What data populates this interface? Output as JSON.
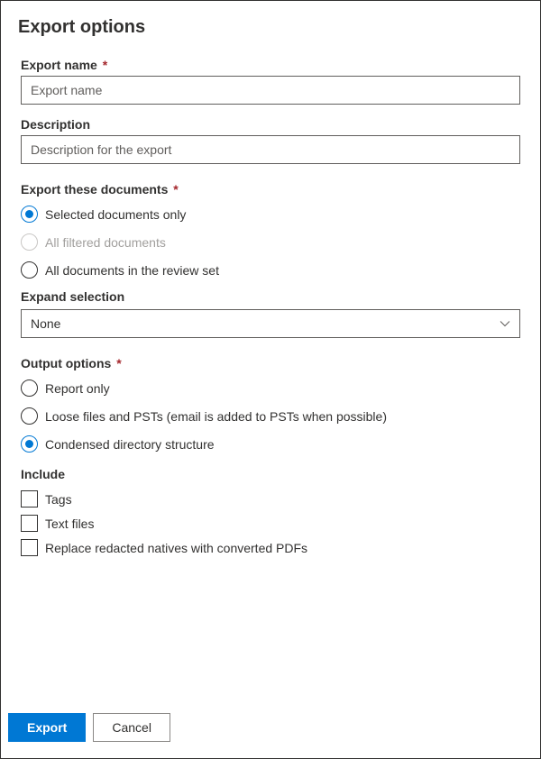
{
  "title": "Export options",
  "fields": {
    "exportName": {
      "label": "Export name",
      "placeholder": "Export name",
      "required": "*"
    },
    "description": {
      "label": "Description",
      "placeholder": "Description for the export"
    }
  },
  "exportDocuments": {
    "label": "Export these documents",
    "required": "*",
    "options": {
      "selected": "Selected documents only",
      "filtered": "All filtered documents",
      "all": "All documents in the review set"
    }
  },
  "expandSelection": {
    "label": "Expand selection",
    "value": "None"
  },
  "outputOptions": {
    "label": "Output options",
    "required": "*",
    "options": {
      "report": "Report only",
      "loose": "Loose files and PSTs (email is added to PSTs when possible)",
      "condensed": "Condensed directory structure"
    }
  },
  "include": {
    "label": "Include",
    "options": {
      "tags": "Tags",
      "textFiles": "Text files",
      "replace": "Replace redacted natives with converted PDFs"
    }
  },
  "buttons": {
    "export": "Export",
    "cancel": "Cancel"
  }
}
